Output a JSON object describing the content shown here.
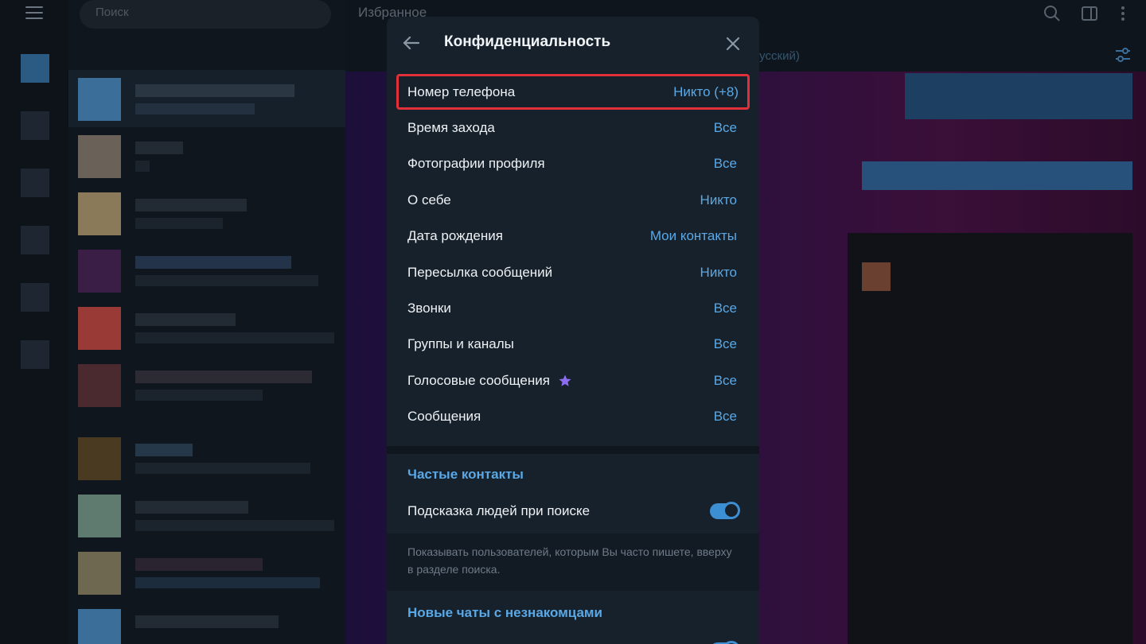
{
  "background": {
    "search_placeholder": "Поиск",
    "chat_title": "Избранное",
    "chat_subtitle": "русский)"
  },
  "modal": {
    "title": "Конфиденциальность",
    "rows": [
      {
        "label": "Номер телефона",
        "value": "Никто (+8)"
      },
      {
        "label": "Время захода",
        "value": "Все"
      },
      {
        "label": "Фотографии профиля",
        "value": "Все"
      },
      {
        "label": "О себе",
        "value": "Никто"
      },
      {
        "label": "Дата рождения",
        "value": "Мои контакты"
      },
      {
        "label": "Пересылка сообщений",
        "value": "Никто"
      },
      {
        "label": "Звонки",
        "value": "Все"
      },
      {
        "label": "Группы и каналы",
        "value": "Все"
      },
      {
        "label": "Голосовые сообщения",
        "value": "Все"
      },
      {
        "label": "Сообщения",
        "value": "Все"
      }
    ],
    "frequent_contacts": {
      "section_title": "Частые контакты",
      "toggle_label": "Подсказка людей при поиске",
      "toggle_on": true,
      "hint": "Показывать пользователей, которым Вы часто пишете, вверху в разделе поиска."
    },
    "new_chats": {
      "section_title": "Новые чаты с незнакомцами"
    }
  },
  "colors": {
    "accent": "#5aa8e5",
    "highlight_border": "#e0303a",
    "premium_star": "#8c6cf0",
    "modal_bg": "#17212b"
  }
}
